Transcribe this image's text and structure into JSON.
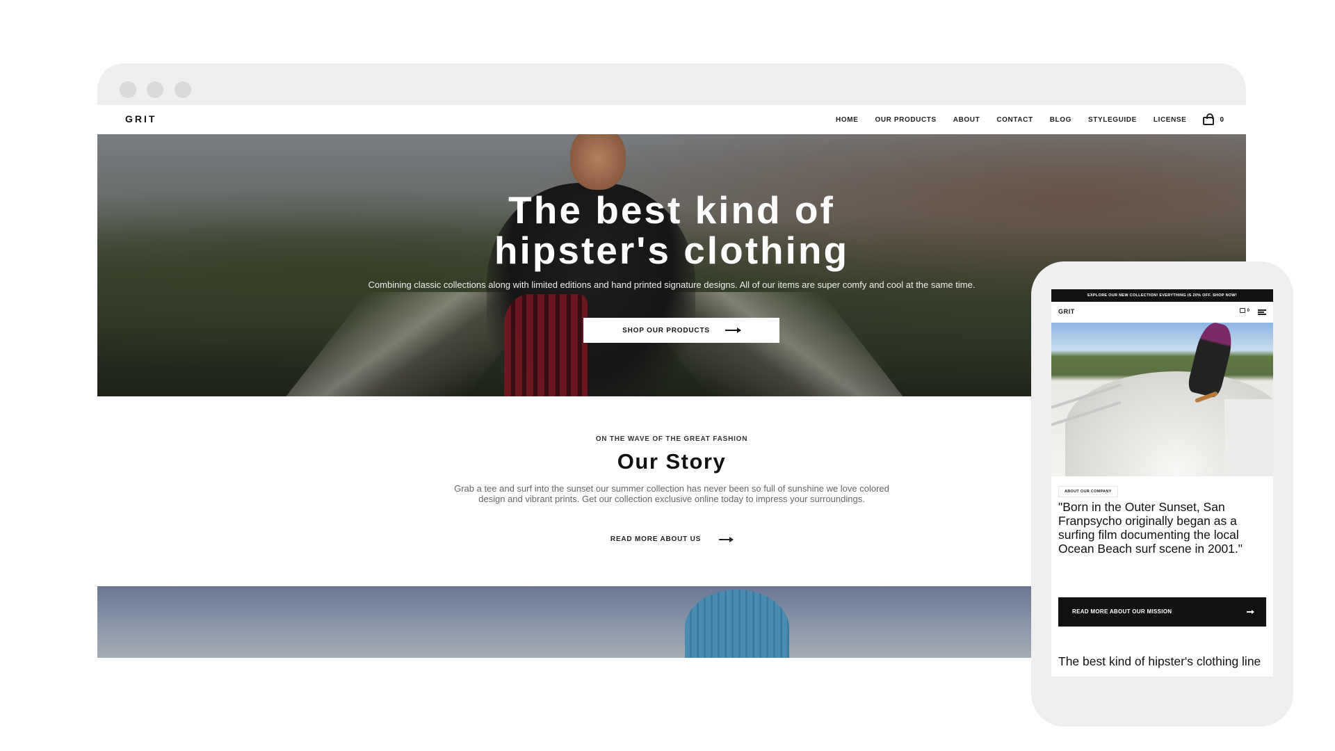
{
  "desktop": {
    "logo": "GRIT",
    "nav": {
      "items": [
        "HOME",
        "OUR PRODUCTS",
        "ABOUT",
        "CONTACT",
        "BLOG",
        "STYLEGUIDE",
        "LICENSE"
      ],
      "cart_count": "0"
    },
    "hero": {
      "title_line1": "The best kind of",
      "title_line2": "hipster's clothing",
      "subtitle": "Combining classic collections along with limited editions and hand printed signature designs. All of our items are super comfy and cool at the same time.",
      "button": "SHOP OUR PRODUCTS"
    },
    "story": {
      "eyebrow": "ON THE WAVE OF THE GREAT FASHION",
      "title": "Our Story",
      "text": "Grab a tee and surf into the sunset our summer collection has never been so full of sunshine we love colored design and vibrant prints. Get our collection exclusive online today to impress your surroundings.",
      "link": "READ MORE ABOUT US"
    }
  },
  "mobile": {
    "announcement": "EXPLORE OUR NEW COLLECTION! EVERYTHING IS 20% OFF. SHOP NOW!",
    "logo": "GRIT",
    "cart_count": "0",
    "tag": "ABOUT OUR COMPANY",
    "quote": "\"Born in the Outer Sunset, San Franpsycho originally began as a surfing film documenting the local Ocean Beach surf scene in 2001.\"",
    "button": "READ MORE ABOUT OUR MISSION",
    "heading": "The best kind of hipster's clothing line"
  },
  "icons": {
    "cart": "shopping-bag-icon",
    "arrow": "arrow-right-icon",
    "menu": "hamburger-menu-icon"
  },
  "colors": {
    "accent": "#111111",
    "background": "#ffffff",
    "chrome": "#efefef"
  }
}
